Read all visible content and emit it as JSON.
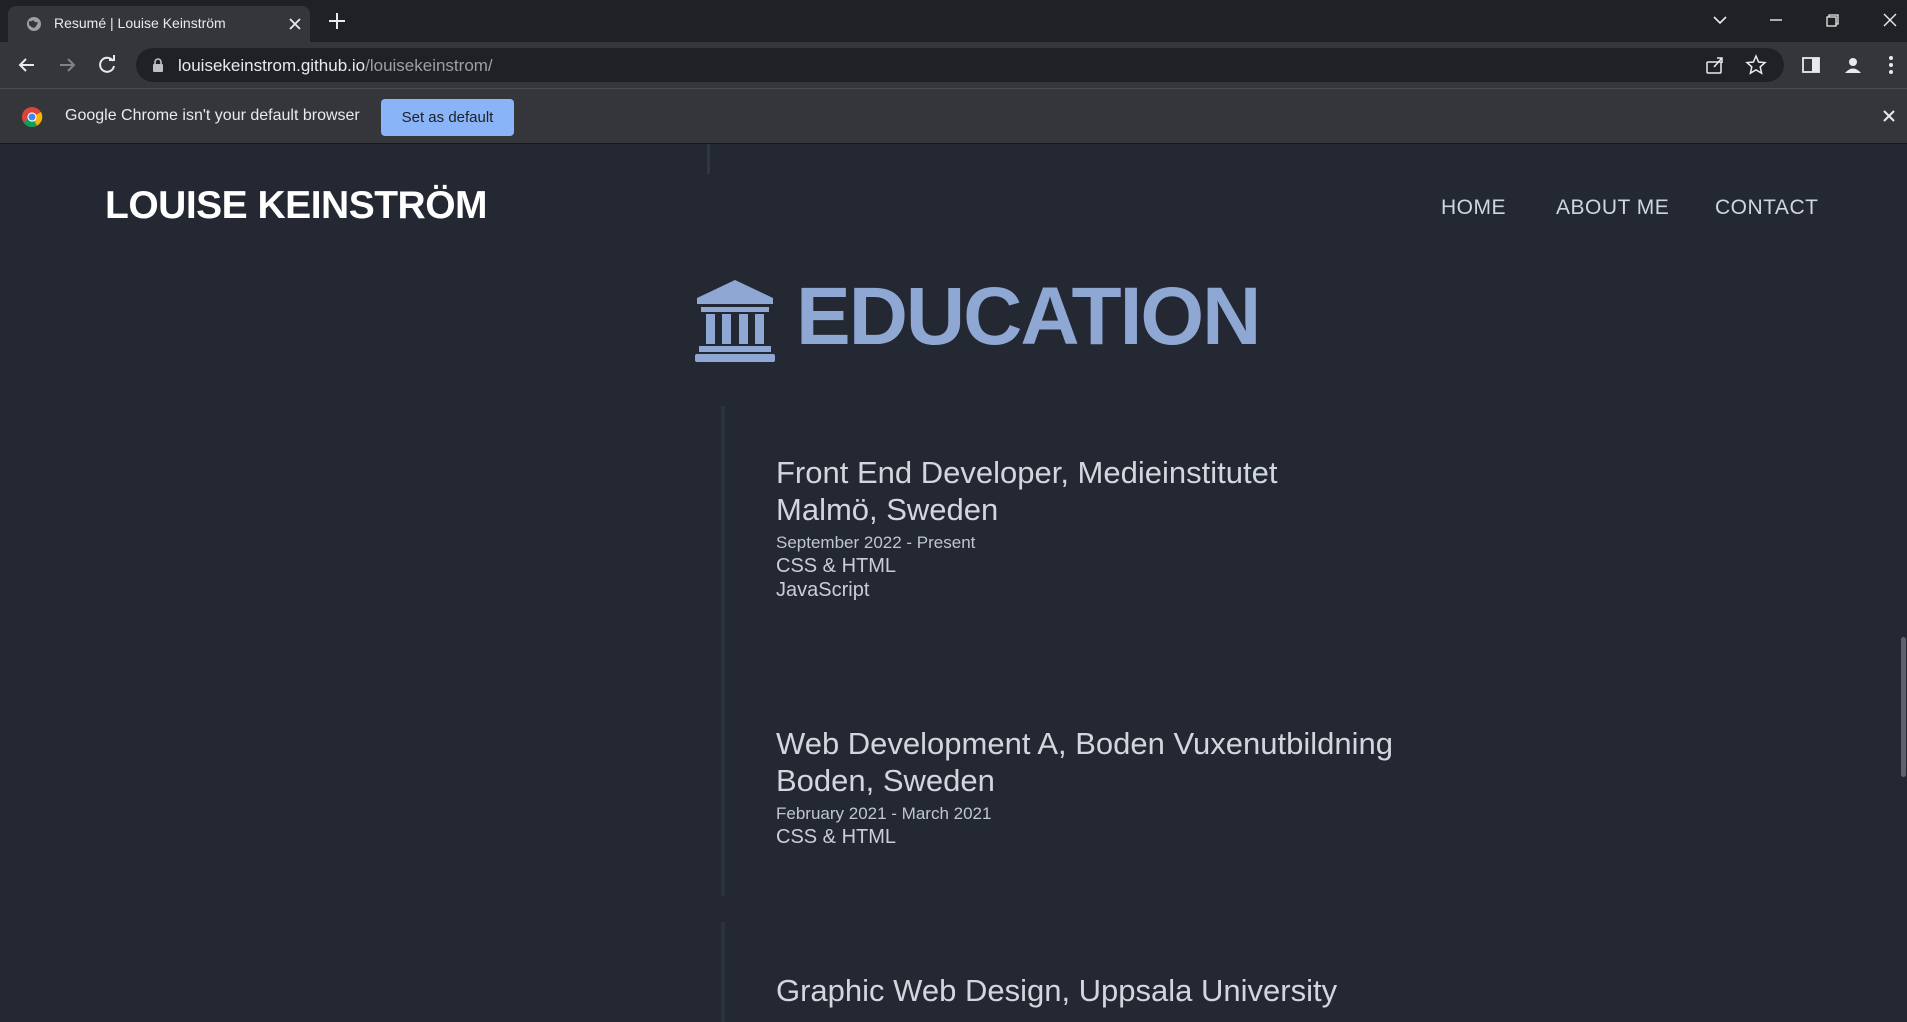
{
  "browser": {
    "tab_title": "Resumé | Louise Keinström",
    "url_host": "louisekeinstrom.github.io",
    "url_path": "/louisekeinstrom/",
    "infobar_text": "Google Chrome isn't your default browser",
    "infobar_button": "Set as default"
  },
  "site": {
    "brand": "LOUISE KEINSTRÖM",
    "nav": [
      "HOME",
      "ABOUT ME",
      "CONTACT"
    ]
  },
  "education": {
    "title": "EDUCATION",
    "icon": "university-icon",
    "accent_color": "#8fa7d3",
    "entries": [
      {
        "line1": "Front End Developer, Medieinstitutet",
        "line2": "Malmö, Sweden",
        "dates": "September 2022 - Present",
        "skills": [
          "CSS & HTML",
          "JavaScript"
        ]
      },
      {
        "line1": "Web Development A, Boden Vuxenutbildning",
        "line2": "Boden, Sweden",
        "dates": "February 2021 - March 2021",
        "skills": [
          "CSS & HTML"
        ]
      },
      {
        "line1": "Graphic Web Design, Uppsala University",
        "line2": "",
        "dates": "",
        "skills": []
      }
    ]
  }
}
